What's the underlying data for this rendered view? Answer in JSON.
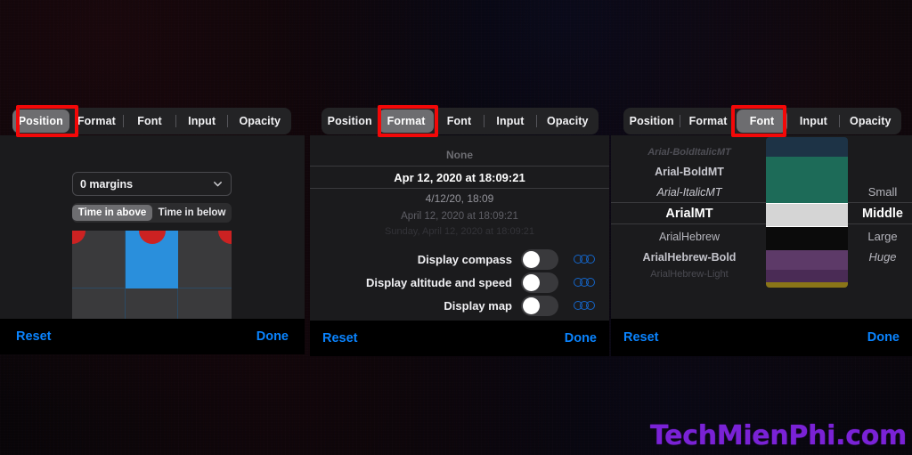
{
  "tabs": [
    "Position",
    "Format",
    "Font",
    "Input",
    "Opacity"
  ],
  "bottom_bar": {
    "reset_label": "Reset",
    "done_label": "Done"
  },
  "watermark": {
    "text": "TechMienPhi.com",
    "color": "#7a22d6"
  },
  "accent_color": "#0a84ff",
  "highlight_box_color": "#f30808",
  "panels": [
    {
      "id": "position-panel",
      "selected_tab": "Position",
      "dropdown": {
        "value": "0 margins",
        "icon": "chevron-down-icon"
      },
      "time_position": {
        "options": [
          "Time in above",
          "Time in below"
        ],
        "selected": "Time in above"
      },
      "position_grid": {
        "columns": 3,
        "rows": 2,
        "selected_cell": {
          "row": 0,
          "col": 1
        },
        "selected_color": "#2a8fdc",
        "handle_color": "#cc2222"
      }
    },
    {
      "id": "format-panel",
      "selected_tab": "Format",
      "date_format_wheel": {
        "items": [
          "None",
          "Apr 12, 2020 at 18:09:21",
          "4/12/20, 18:09",
          "April 12, 2020 at 18:09:21",
          "Sunday, April 12, 2020 at 18:09:21"
        ],
        "selected": "Apr 12, 2020 at 18:09:21"
      },
      "toggles": [
        {
          "label": "Display compass",
          "on": false,
          "icon": "three-circles-icon"
        },
        {
          "label": "Display altitude and speed",
          "on": false,
          "icon": "three-circles-icon"
        },
        {
          "label": "Display map",
          "on": false,
          "icon": "three-circles-icon"
        }
      ]
    },
    {
      "id": "font-panel",
      "selected_tab": "Font",
      "font_wheel": {
        "items": [
          "Arial-BoldItalicMT",
          "Arial-BoldMT",
          "Arial-ItalicMT",
          "ArialMT",
          "ArialHebrew",
          "ArialHebrew-Bold",
          "ArialHebrew-Light"
        ],
        "selected": "ArialMT"
      },
      "color_wheel": {
        "swatches": [
          "#1d3346",
          "#1d6b58",
          "#1d6b58",
          "#d5d5d5",
          "#0b0b0b",
          "#5d3a68",
          "#4a2b55",
          "#8a7518"
        ],
        "selected": "#d5d5d5",
        "selected_index": 3
      },
      "size_wheel": {
        "items": [
          "Small",
          "Middle",
          "Large",
          "Huge"
        ],
        "selected": "Middle"
      }
    }
  ]
}
